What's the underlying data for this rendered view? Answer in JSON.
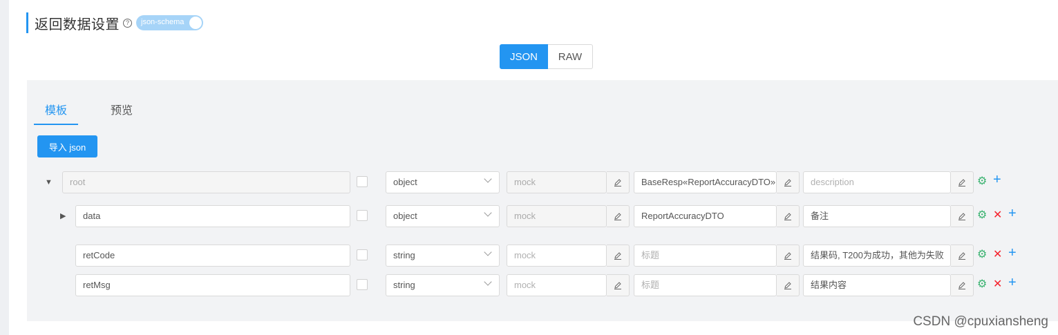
{
  "header": {
    "title": "返回数据设置",
    "help_icon": "?",
    "toggle_label": "json-schema"
  },
  "mode": {
    "json": "JSON",
    "raw": "RAW"
  },
  "tabs": {
    "template": "模板",
    "preview": "预览"
  },
  "import_label": "导入 json",
  "rows": [
    {
      "name": "root",
      "type": "object",
      "mock": "mock",
      "title": "BaseResp«ReportAccuracyDTO»",
      "desc": "description"
    },
    {
      "name": "data",
      "type": "object",
      "mock": "mock",
      "title": "ReportAccuracyDTO",
      "desc": "备注"
    },
    {
      "name": "retCode",
      "type": "string",
      "mock": "mock",
      "title": "标题",
      "desc": "结果码, T200为成功，其他为失败"
    },
    {
      "name": "retMsg",
      "type": "string",
      "mock": "mock",
      "title": "标题",
      "desc": "结果内容"
    }
  ],
  "icons": {
    "expand": "▼",
    "collapse": "▶",
    "gear": "⚙",
    "close": "✕",
    "plus": "+"
  },
  "watermark": "CSDN @cpuxiansheng",
  "colors": {
    "accent": "#2395f1",
    "panel_bg": "#f2f3f5",
    "gear": "#3cb371",
    "close": "#f5222d"
  }
}
